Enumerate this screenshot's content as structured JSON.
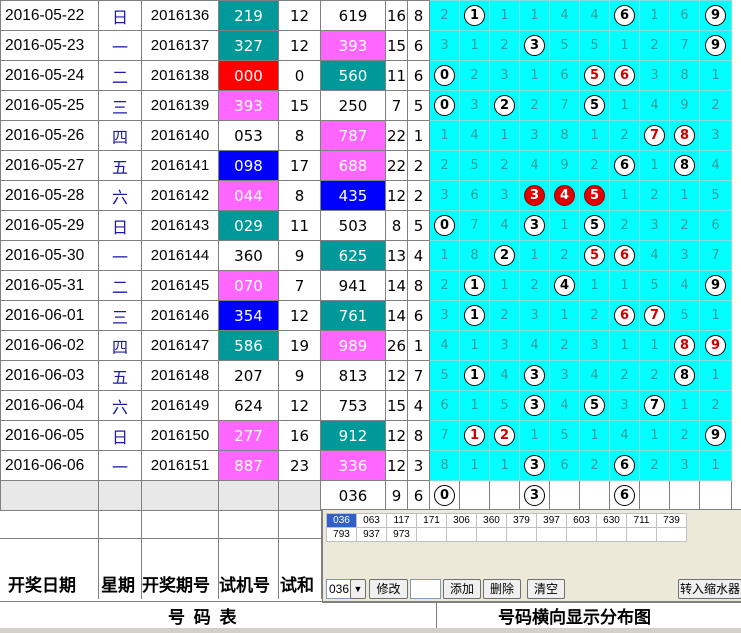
{
  "rows": [
    {
      "date": "2016-05-22",
      "week": "日",
      "issue": "2016136",
      "test": "219",
      "test_sum": "12",
      "result": "619",
      "result_sum": "16",
      "n6": "8",
      "dist": [
        "2",
        "1",
        "1",
        "1",
        "4",
        "4",
        "6",
        "1",
        "6",
        "9"
      ],
      "balls": [
        1,
        6,
        9
      ],
      "test_hl": "teal",
      "result_hl": ""
    },
    {
      "date": "2016-05-23",
      "week": "一",
      "issue": "2016137",
      "test": "327",
      "test_sum": "12",
      "result": "393",
      "result_sum": "15",
      "n6": "6",
      "dist": [
        "3",
        "1",
        "2",
        "3",
        "5",
        "5",
        "1",
        "2",
        "7",
        "9"
      ],
      "balls": [
        3,
        9
      ],
      "test_hl": "teal",
      "result_hl": "magenta"
    },
    {
      "date": "2016-05-24",
      "week": "二",
      "issue": "2016138",
      "test": "000",
      "test_sum": "0",
      "result": "560",
      "result_sum": "11",
      "n6": "6",
      "dist": [
        "0",
        "2",
        "3",
        "1",
        "6",
        "5",
        "6",
        "3",
        "8",
        "1"
      ],
      "balls": [
        0,
        5,
        6
      ],
      "test_hl": "red",
      "result_hl": "teal"
    },
    {
      "date": "2016-05-25",
      "week": "三",
      "issue": "2016139",
      "test": "393",
      "test_sum": "15",
      "result": "250",
      "result_sum": "7",
      "n6": "5",
      "dist": [
        "0",
        "3",
        "2",
        "2",
        "7",
        "5",
        "1",
        "4",
        "9",
        "2"
      ],
      "balls": [
        0,
        2,
        5
      ],
      "test_hl": "magenta",
      "result_hl": ""
    },
    {
      "date": "2016-05-26",
      "week": "四",
      "issue": "2016140",
      "test": "053",
      "test_sum": "8",
      "result": "787",
      "result_sum": "22",
      "n6": "1",
      "dist": [
        "1",
        "4",
        "1",
        "3",
        "8",
        "1",
        "2",
        "7",
        "8",
        "3"
      ],
      "balls": [
        7,
        8
      ],
      "test_hl": "",
      "result_hl": "magenta"
    },
    {
      "date": "2016-05-27",
      "week": "五",
      "issue": "2016141",
      "test": "098",
      "test_sum": "17",
      "result": "688",
      "result_sum": "22",
      "n6": "2",
      "dist": [
        "2",
        "5",
        "2",
        "4",
        "9",
        "2",
        "6",
        "1",
        "8",
        "4"
      ],
      "balls": [
        6,
        8
      ],
      "test_hl": "blue",
      "result_hl": "magenta"
    },
    {
      "date": "2016-05-28",
      "week": "六",
      "issue": "2016142",
      "test": "044",
      "test_sum": "8",
      "result": "435",
      "result_sum": "12",
      "n6": "2",
      "dist": [
        "3",
        "6",
        "3",
        "3",
        "4",
        "5",
        "1",
        "2",
        "1",
        "5"
      ],
      "balls": [
        3,
        4,
        5
      ],
      "test_hl": "magenta",
      "result_hl": "blue"
    },
    {
      "date": "2016-05-29",
      "week": "日",
      "issue": "2016143",
      "test": "029",
      "test_sum": "11",
      "result": "503",
      "result_sum": "8",
      "n6": "5",
      "dist": [
        "0",
        "7",
        "4",
        "3",
        "1",
        "5",
        "2",
        "3",
        "2",
        "6"
      ],
      "balls": [
        0,
        3,
        5
      ],
      "test_hl": "teal",
      "result_hl": ""
    },
    {
      "date": "2016-05-30",
      "week": "一",
      "issue": "2016144",
      "test": "360",
      "test_sum": "9",
      "result": "625",
      "result_sum": "13",
      "n6": "4",
      "dist": [
        "1",
        "8",
        "2",
        "1",
        "2",
        "5",
        "6",
        "4",
        "3",
        "7"
      ],
      "balls": [
        2,
        5,
        6
      ],
      "test_hl": "",
      "result_hl": "teal"
    },
    {
      "date": "2016-05-31",
      "week": "二",
      "issue": "2016145",
      "test": "070",
      "test_sum": "7",
      "result": "941",
      "result_sum": "14",
      "n6": "8",
      "dist": [
        "2",
        "1",
        "1",
        "2",
        "4",
        "1",
        "1",
        "5",
        "4",
        "9"
      ],
      "balls": [
        1,
        4,
        9
      ],
      "test_hl": "magenta",
      "result_hl": ""
    },
    {
      "date": "2016-06-01",
      "week": "三",
      "issue": "2016146",
      "test": "354",
      "test_sum": "12",
      "result": "761",
      "result_sum": "14",
      "n6": "6",
      "dist": [
        "3",
        "1",
        "2",
        "3",
        "1",
        "2",
        "6",
        "7",
        "5",
        "1"
      ],
      "balls": [
        1,
        6,
        7
      ],
      "test_hl": "blue",
      "result_hl": "teal"
    },
    {
      "date": "2016-06-02",
      "week": "四",
      "issue": "2016147",
      "test": "586",
      "test_sum": "19",
      "result": "989",
      "result_sum": "26",
      "n6": "1",
      "dist": [
        "4",
        "1",
        "3",
        "4",
        "2",
        "3",
        "1",
        "1",
        "8",
        "9"
      ],
      "balls": [
        8,
        9
      ],
      "test_hl": "teal",
      "result_hl": "magenta"
    },
    {
      "date": "2016-06-03",
      "week": "五",
      "issue": "2016148",
      "test": "207",
      "test_sum": "9",
      "result": "813",
      "result_sum": "12",
      "n6": "7",
      "dist": [
        "5",
        "1",
        "4",
        "3",
        "3",
        "4",
        "2",
        "2",
        "8",
        "1"
      ],
      "balls": [
        1,
        3,
        8
      ],
      "test_hl": "",
      "result_hl": ""
    },
    {
      "date": "2016-06-04",
      "week": "六",
      "issue": "2016149",
      "test": "624",
      "test_sum": "12",
      "result": "753",
      "result_sum": "15",
      "n6": "4",
      "dist": [
        "6",
        "1",
        "5",
        "3",
        "4",
        "5",
        "3",
        "7",
        "1",
        "2"
      ],
      "balls": [
        3,
        5,
        7
      ],
      "test_hl": "",
      "result_hl": ""
    },
    {
      "date": "2016-06-05",
      "week": "日",
      "issue": "2016150",
      "test": "277",
      "test_sum": "16",
      "result": "912",
      "result_sum": "12",
      "n6": "8",
      "dist": [
        "7",
        "1",
        "2",
        "1",
        "5",
        "1",
        "4",
        "1",
        "2",
        "9"
      ],
      "balls": [
        1,
        2,
        9
      ],
      "test_hl": "magenta",
      "result_hl": "teal"
    },
    {
      "date": "2016-06-06",
      "week": "一",
      "issue": "2016151",
      "test": "887",
      "test_sum": "23",
      "result": "336",
      "result_sum": "12",
      "n6": "3",
      "dist": [
        "8",
        "1",
        "1",
        "3",
        "6",
        "2",
        "6",
        "2",
        "3",
        "1"
      ],
      "balls": [
        3,
        6
      ],
      "test_hl": "magenta",
      "result_hl": "magenta"
    }
  ],
  "summary_row": {
    "result": "036",
    "result_sum": "9",
    "n6": "6",
    "dist": [
      "0",
      "",
      "",
      "3",
      "",
      "",
      "6",
      "",
      "",
      ""
    ],
    "balls": [
      0,
      3,
      6
    ]
  },
  "headers": {
    "date": "开奖日期",
    "week": "星期",
    "issue": "开奖期号",
    "test": "试机号",
    "test_sum": "试和"
  },
  "captions": {
    "left": "号  码  表",
    "right": "号码横向显示分布图"
  },
  "panel": {
    "numbers_row1": [
      "036",
      "063",
      "117",
      "171",
      "306",
      "360",
      "379",
      "397",
      "603",
      "630",
      "711",
      "739"
    ],
    "numbers_row2": [
      "793",
      "937",
      "973"
    ],
    "selected": "036",
    "select_value": "036",
    "buttons": {
      "modify": "修改",
      "add": "添加",
      "delete": "删除",
      "clear": "清空",
      "transfer": "转入缩水器"
    }
  },
  "colors": {
    "teal": "#009999",
    "magenta": "#ff66ff",
    "red": "#ff0000",
    "blue": "#0000ff",
    "cyan": "#00ffff"
  }
}
